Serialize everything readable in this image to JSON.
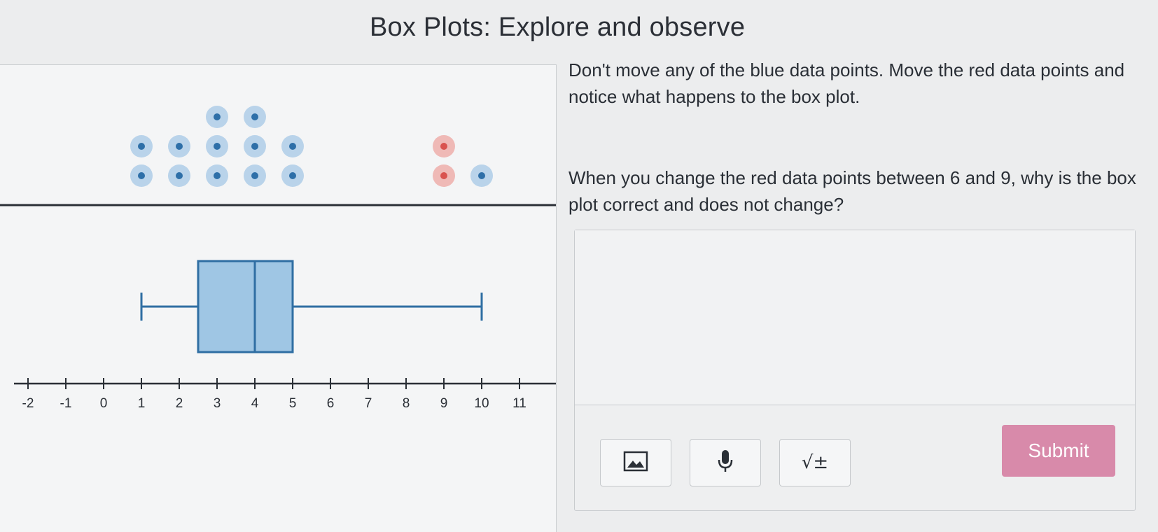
{
  "page": {
    "title": "Box Plots: Explore and observe"
  },
  "instructions": {
    "paragraph1": "Don't move any of the blue data points. Move the red data points and notice what happens to the box plot.",
    "paragraph2": "When you change the red data points between 6 and 9, why is the box plot correct and does not change?"
  },
  "answer": {
    "value": "",
    "placeholder": ""
  },
  "toolbar": {
    "image_icon": "image-icon",
    "mic_icon": "microphone-icon",
    "math_label": "√±",
    "submit_label": "Submit"
  },
  "colors": {
    "blue_point": "#2e6fa8",
    "blue_halo": "#b9d3ea",
    "red_point": "#d9534f",
    "red_halo": "#efb9b6",
    "box_fill": "#9fc6e4",
    "box_stroke": "#2f6ea3",
    "submit": "#d88aaa"
  },
  "chart_data": {
    "type": "box",
    "axis": {
      "min": -2,
      "max": 11,
      "tick_labels": [
        "-2",
        "-1",
        "0",
        "1",
        "2",
        "3",
        "4",
        "5",
        "6",
        "7",
        "8",
        "9",
        "10",
        "11"
      ]
    },
    "blue_points": [
      1,
      1,
      2,
      2,
      3,
      3,
      3,
      4,
      4,
      4,
      5,
      5,
      10
    ],
    "red_points": [
      9,
      9
    ],
    "box_plot": {
      "min": 1,
      "q1": 2.5,
      "median": 4,
      "q3": 5,
      "max": 10
    }
  }
}
